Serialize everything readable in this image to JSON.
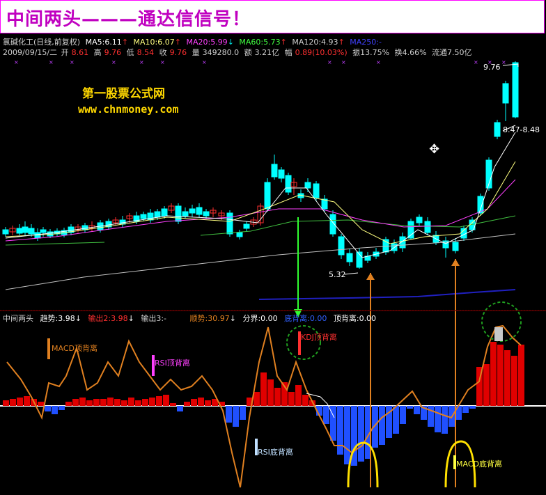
{
  "title": "中间两头———通达信信号！",
  "price_info": {
    "name": "氯碱化工(日线,前复权)",
    "ma5": "MA5:6.11",
    "ma10": "MA10:6.07",
    "ma20": "MA20:5.99",
    "ma60": "MA60:5.73",
    "ma120": "MA120:4.93",
    "ma250": "MA250:-",
    "date": "2009/09/15/二",
    "open_label": "开",
    "open": "8.61",
    "high_label": "高",
    "high": "9.76",
    "low_label": "低",
    "low": "8.54",
    "close_label": "收",
    "close": "9.76",
    "vol_label": "量",
    "vol": "349280.0",
    "amt_label": "额",
    "amt": "3.21亿",
    "chg_label": "幅",
    "chg": "0.89(10.03%)",
    "amp": "振13.75%",
    "turnover": "换4.66%",
    "float": "流通7.50亿"
  },
  "watermark": {
    "line1": "第一股票公式网",
    "line2": "www.chnmoney.com"
  },
  "price_labels": {
    "high": "9.76",
    "range": "8.47-8.48",
    "low": "5.32"
  },
  "indicator_info": {
    "name": "中间两头",
    "trend": "趋势:3.98",
    "out2": "输出2:3.98",
    "out3": "输出3:-",
    "momentum": "顺势:30.97",
    "fenjie": "分界:0.00",
    "bottom_div": "底背离:0.00",
    "top_div": "顶背离:0.00"
  },
  "annotations": {
    "kdj_top": "KDJ顶背离",
    "macd_top": "MACD顶背离",
    "rsi_top": "RSI顶背离",
    "rsi_bottom": "RSI底背离",
    "macd_bottom": "MACD底背离"
  },
  "colors": {
    "up": "#ff3030",
    "down": "#00ffff",
    "bg": "#000000",
    "title": "#c000c0",
    "ma5": "#ffffff",
    "ma10": "#ffff80",
    "ma20": "#ff40ff",
    "ma60": "#40c040",
    "ma120": "#c0c0c0",
    "ma250": "#2020c0",
    "hist_up": "#e00000",
    "hist_down": "#2050ff",
    "trend": "#e08020"
  }
}
